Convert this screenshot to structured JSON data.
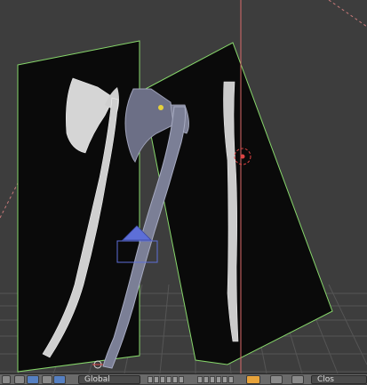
{
  "viewport": {
    "background": "#3d3d3d",
    "grid_color": "#5a5a5a",
    "selection_outline": "#86d66a",
    "plane_fill": "#0a0a0a",
    "axis_line_color": "#d96a6a",
    "manipulator_color": "#5d6fd8",
    "cursor_icon": "3d-cursor-icon",
    "manipulator_icon": "transform-manipulator-icon"
  },
  "header": {
    "pivot_dropdown_label": "",
    "orientation_dropdown_label": "Global",
    "snap_dropdown_label": "Clos",
    "icons": [
      "layer-icon",
      "pivot-icon",
      "manipulator-icon",
      "rotate-icon",
      "scale-icon",
      "layers-icon",
      "lock-icon",
      "proportional-edit-icon",
      "snap-icon",
      "render-icon"
    ]
  }
}
